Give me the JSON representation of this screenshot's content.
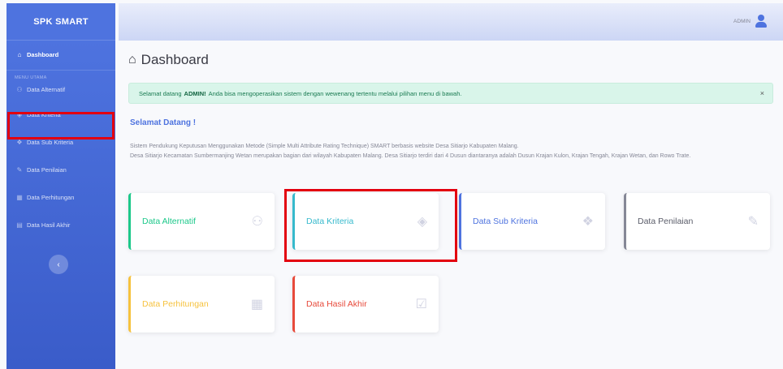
{
  "sidebar": {
    "brand": "SPK SMART",
    "dashboard": {
      "label": "Dashboard",
      "icon": "home-icon"
    },
    "section_heading": "MENU UTAMA",
    "items": [
      {
        "label": "Data Alternatif",
        "icon": "users-icon"
      },
      {
        "label": "Data Kriteria",
        "icon": "cube-icon"
      },
      {
        "label": "Data Sub Kriteria",
        "icon": "cubes-icon"
      },
      {
        "label": "Data Penilaian",
        "icon": "edit-icon"
      },
      {
        "label": "Data Perhitungan",
        "icon": "calculator-icon"
      },
      {
        "label": "Data Hasil Akhir",
        "icon": "chart-icon"
      }
    ],
    "toggle_icon": "chevron-left-icon"
  },
  "topbar": {
    "user": "ADMIN",
    "icon": "user-icon"
  },
  "main": {
    "title": "Dashboard",
    "alert": {
      "prefix": "Selamat datang",
      "user": "ADMIN!",
      "suffix": "Anda bisa mengoperasikan sistem dengan wewenang tertentu melalui pilihan menu di bawah.",
      "close": "×"
    },
    "welcome": "Selamat Datang !",
    "description_1": "Sistem Pendukung Keputusan Menggunakan Metode (Simple Multi Attribute Rating Technique) SMART berbasis website Desa Sitiarjo Kabupaten Malang.",
    "description_2": "Desa Sitiarjo Kecamatan Sumbermanjing Wetan merupakan bagian dari wilayah Kabupaten Malang. Desa Sitiarjo terdiri dari 4 Dusun diantaranya adalah Dusun Krajan Kulon, Krajan Tengah, Krajan Wetan, dan Rowo Trate.",
    "cards": [
      {
        "label": "Data Alternatif",
        "icon": "users-icon",
        "color": "#1cc88a"
      },
      {
        "label": "Data Kriteria",
        "icon": "cube-icon",
        "color": "#36b9cc"
      },
      {
        "label": "Data Sub Kriteria",
        "icon": "cubes-icon",
        "color": "#4e73df"
      },
      {
        "label": "Data Penilaian",
        "icon": "edit-icon",
        "color": "#858796"
      },
      {
        "label": "Data Perhitungan",
        "icon": "calculator-icon",
        "color": "#f6c23e"
      },
      {
        "label": "Data Hasil Akhir",
        "icon": "calendar-check-icon",
        "color": "#e74a3b"
      }
    ]
  },
  "highlight_color": "#e3000f"
}
